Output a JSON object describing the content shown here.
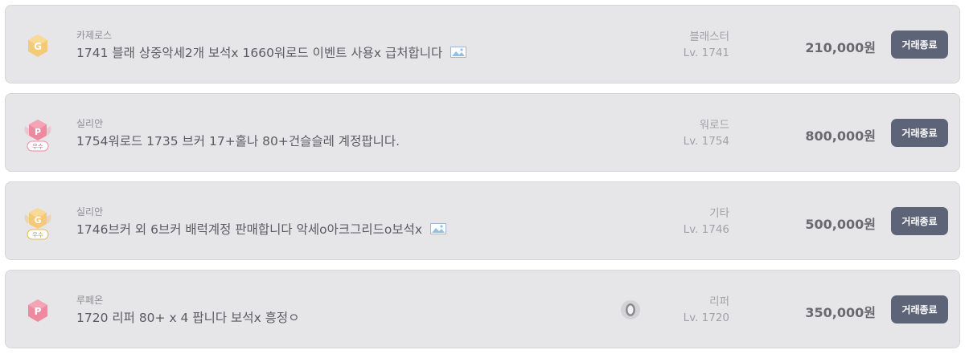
{
  "listings": [
    {
      "server": "카제로스",
      "title": "1741 블래 상중악세2개 보석x 1660워로드 이벤트 사용x 급처합니다",
      "has_image": true,
      "class_name": "블래스터",
      "level": "Lv. 1741",
      "price": "210,000원",
      "button": "거래종료",
      "badge": "g-badge-icon",
      "badge_label": ""
    },
    {
      "server": "실리안",
      "title": "1754워로드 1735 브커 17+홀나 80+건슬슬레 계정팝니다.",
      "has_image": false,
      "class_name": "워로드",
      "level": "Lv. 1754",
      "price": "800,000원",
      "button": "거래종료",
      "badge": "p-badge-excellent-icon",
      "badge_label": "우수"
    },
    {
      "server": "실리안",
      "title": "1746브커 외 6브커 배럭계정 판매합니다 악세o아크그리드o보석x",
      "has_image": true,
      "class_name": "기타",
      "level": "Lv. 1746",
      "price": "500,000원",
      "button": "거래종료",
      "badge": "g-badge-excellent-icon",
      "badge_label": "우수"
    },
    {
      "server": "루페온",
      "title": "1720 리퍼 80+ x 4 팝니다 보석x 흥정ㅇ",
      "has_image": false,
      "class_name": "리퍼",
      "level": "Lv. 1720",
      "price": "350,000원",
      "button": "거래종료",
      "badge": "p-badge-icon",
      "badge_label": ""
    }
  ],
  "colors": {
    "card_bg": "#e6e6e8",
    "button_bg": "#5e6478",
    "g_badge": "#f4c978",
    "p_badge": "#ee8aa0"
  }
}
